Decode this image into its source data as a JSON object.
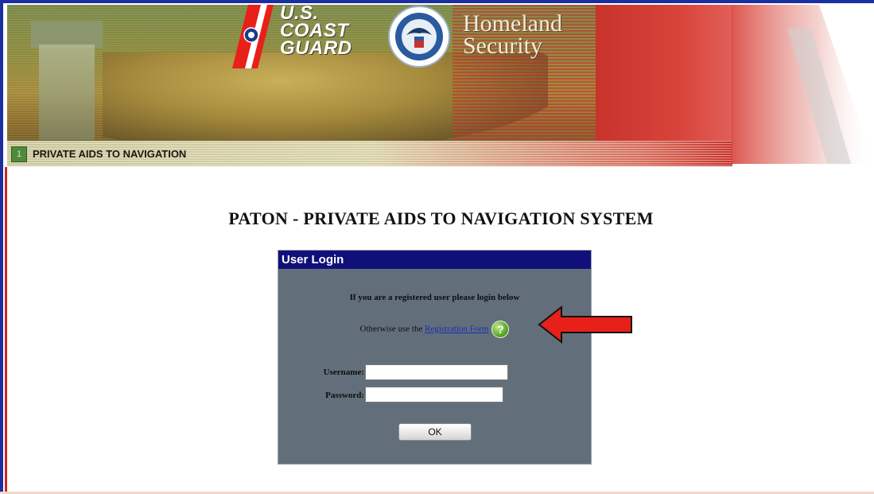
{
  "banner": {
    "agency_line1": "U.S.",
    "agency_line2": "COAST",
    "agency_line3": "GUARD",
    "dept_line1": "Homeland",
    "dept_line2": "Security",
    "nav_number": "1",
    "nav_label": "PRIVATE AIDS TO NAVIGATION"
  },
  "page": {
    "title": "PATON - PRIVATE AIDS TO NAVIGATION SYSTEM"
  },
  "login": {
    "header": "User Login",
    "message": "If you are a registered user please login below",
    "register_prefix": "Otherwise use the ",
    "register_link": "Registration Form",
    "help_icon": "?",
    "username_label": "Username:",
    "username_value": "",
    "password_label": "Password:",
    "password_value": "",
    "ok_label": "OK"
  },
  "colors": {
    "frame_blue": "#1a2fa0",
    "login_header": "#10107a",
    "login_bg": "#626f7b",
    "arrow_red": "#e8201a",
    "link_blue": "#1a2ab8"
  },
  "icons": [
    "coast-guard-emblem-icon",
    "dhs-seal-icon",
    "help-icon",
    "red-arrow-icon"
  ]
}
